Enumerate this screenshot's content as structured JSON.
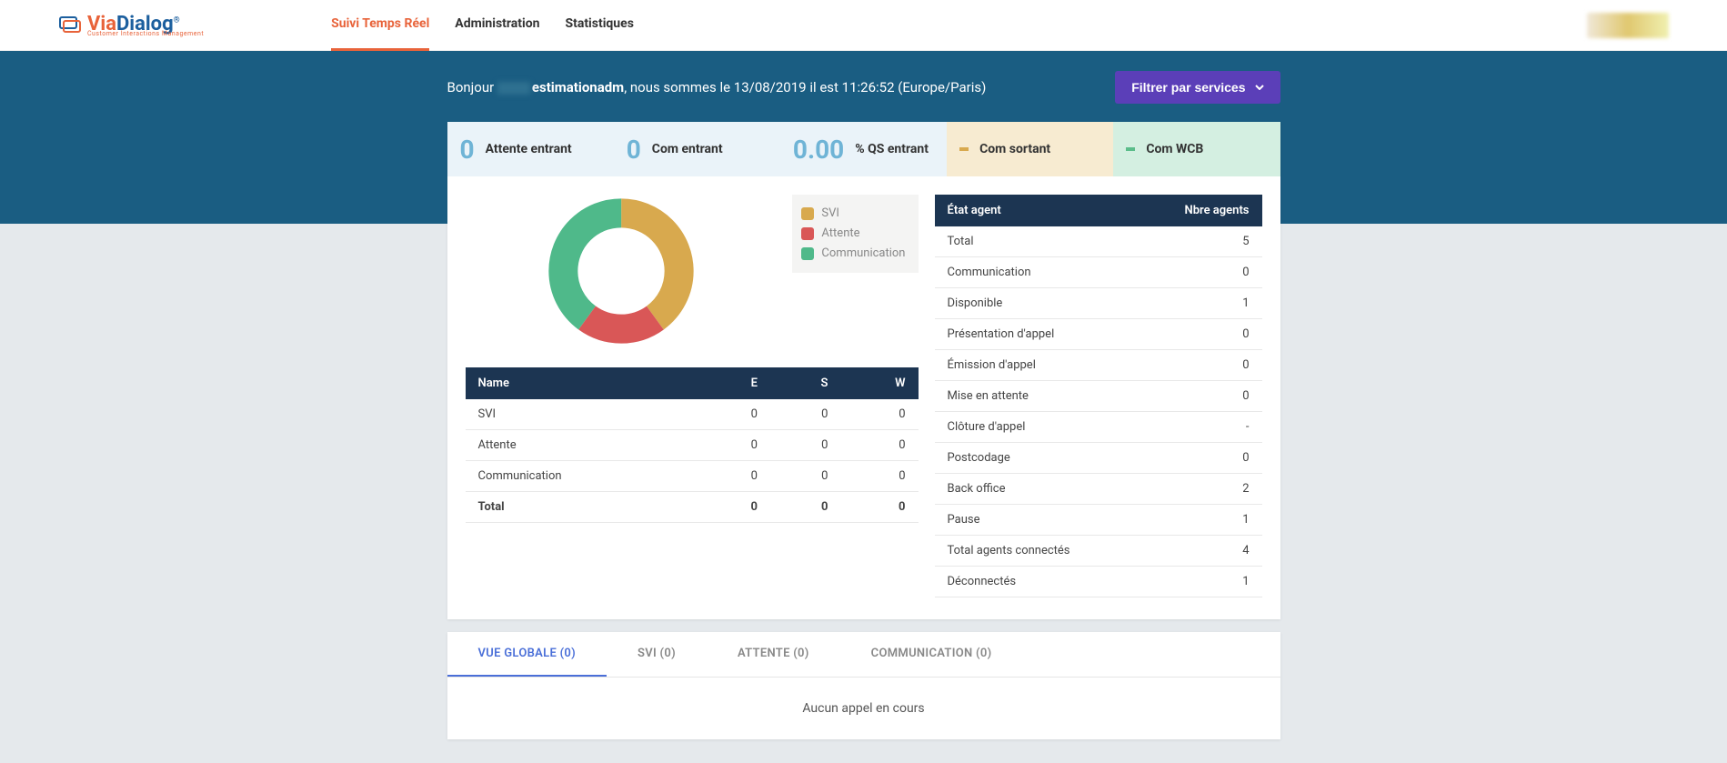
{
  "brand": {
    "via": "Via",
    "dialog": "Dialog",
    "sub": "Customer Interactions Management"
  },
  "nav": {
    "realtime": "Suivi Temps Réel",
    "admin": "Administration",
    "stats": "Statistiques"
  },
  "greeting": {
    "hello": "Bonjour",
    "user_suffix": "estimationadm",
    "rest": ", nous sommes le 13/08/2019 il est 11:26:52 (Europe/Paris)"
  },
  "filter_button": "Filtrer par services",
  "kpis": {
    "wait_in": {
      "value": "0",
      "label": "Attente entrant"
    },
    "com_in": {
      "value": "0",
      "label": "Com entrant"
    },
    "qs_in": {
      "value": "0.00",
      "label": "% QS entrant"
    },
    "com_out": {
      "label": "Com sortant"
    },
    "com_wcb": {
      "label": "Com WCB"
    }
  },
  "chart_data": {
    "type": "pie",
    "title": "",
    "series": [
      {
        "name": "SVI",
        "value": 40,
        "color": "#d8a94e"
      },
      {
        "name": "Attente",
        "value": 20,
        "color": "#d95757"
      },
      {
        "name": "Communication",
        "value": 40,
        "color": "#4fb98a"
      }
    ],
    "legend_labels": [
      "SVI",
      "Attente",
      "Communication"
    ],
    "donut": true
  },
  "left_table": {
    "headers": {
      "name": "Name",
      "e": "E",
      "s": "S",
      "w": "W"
    },
    "rows": [
      {
        "name": "SVI",
        "e": "0",
        "s": "0",
        "w": "0"
      },
      {
        "name": "Attente",
        "e": "0",
        "s": "0",
        "w": "0"
      },
      {
        "name": "Communication",
        "e": "0",
        "s": "0",
        "w": "0"
      }
    ],
    "total": {
      "name": "Total",
      "e": "0",
      "s": "0",
      "w": "0"
    }
  },
  "agent_table": {
    "headers": {
      "state": "État agent",
      "count": "Nbre agents"
    },
    "rows": [
      {
        "state": "Total",
        "count": "5"
      },
      {
        "state": "Communication",
        "count": "0"
      },
      {
        "state": "Disponible",
        "count": "1"
      },
      {
        "state": "Présentation d'appel",
        "count": "0"
      },
      {
        "state": "Émission d'appel",
        "count": "0"
      },
      {
        "state": "Mise en attente",
        "count": "0"
      },
      {
        "state": "Clôture d'appel",
        "count": "-"
      },
      {
        "state": "Postcodage",
        "count": "0"
      },
      {
        "state": "Back office",
        "count": "2"
      },
      {
        "state": "Pause",
        "count": "1"
      },
      {
        "state": "Total agents connectés",
        "count": "4"
      },
      {
        "state": "Déconnectés",
        "count": "1"
      }
    ]
  },
  "tabs": {
    "global": "VUE GLOBALE (0)",
    "svi": "SVI (0)",
    "attente": "ATTENTE (0)",
    "comm": "COMMUNICATION (0)"
  },
  "tab_body": "Aucun appel en cours"
}
